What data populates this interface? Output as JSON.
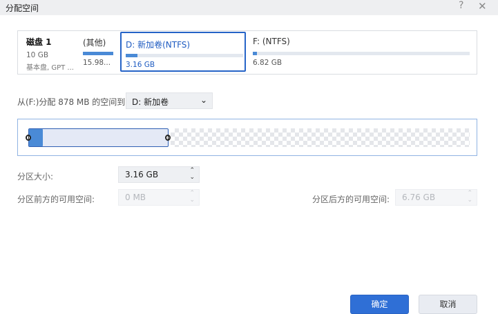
{
  "window": {
    "title": "分配空间",
    "help_icon": "question-icon",
    "close_icon": "close-icon"
  },
  "disk": {
    "name": "磁盘 1",
    "size": "10 GB",
    "type": "基本盘, GPT ..."
  },
  "partitions": [
    {
      "label": "(其他)",
      "size": "15.98...",
      "usage": 1.0
    },
    {
      "label": "D: 新加卷(NTFS)",
      "size": "3.16 GB",
      "usage": 0.1,
      "selected": true
    },
    {
      "label": "F: (NTFS)",
      "size": "6.82 GB",
      "usage": 0.01
    }
  ],
  "allocate": {
    "from_label": "从(F:)分配 878 MB 的空间到",
    "target": "D: 新加卷"
  },
  "resize": {
    "partition_fraction": 0.32,
    "used_fraction": 0.1
  },
  "fields": {
    "size_label": "分区大小:",
    "size_value": "3.16 GB",
    "before_label": "分区前方的可用空间:",
    "before_value": "0 MB",
    "after_label": "分区后方的可用空间:",
    "after_value": "6.76 GB"
  },
  "buttons": {
    "ok": "确定",
    "cancel": "取消"
  },
  "colors": {
    "accent": "#2f6fd6",
    "used": "#4a8ad6"
  }
}
